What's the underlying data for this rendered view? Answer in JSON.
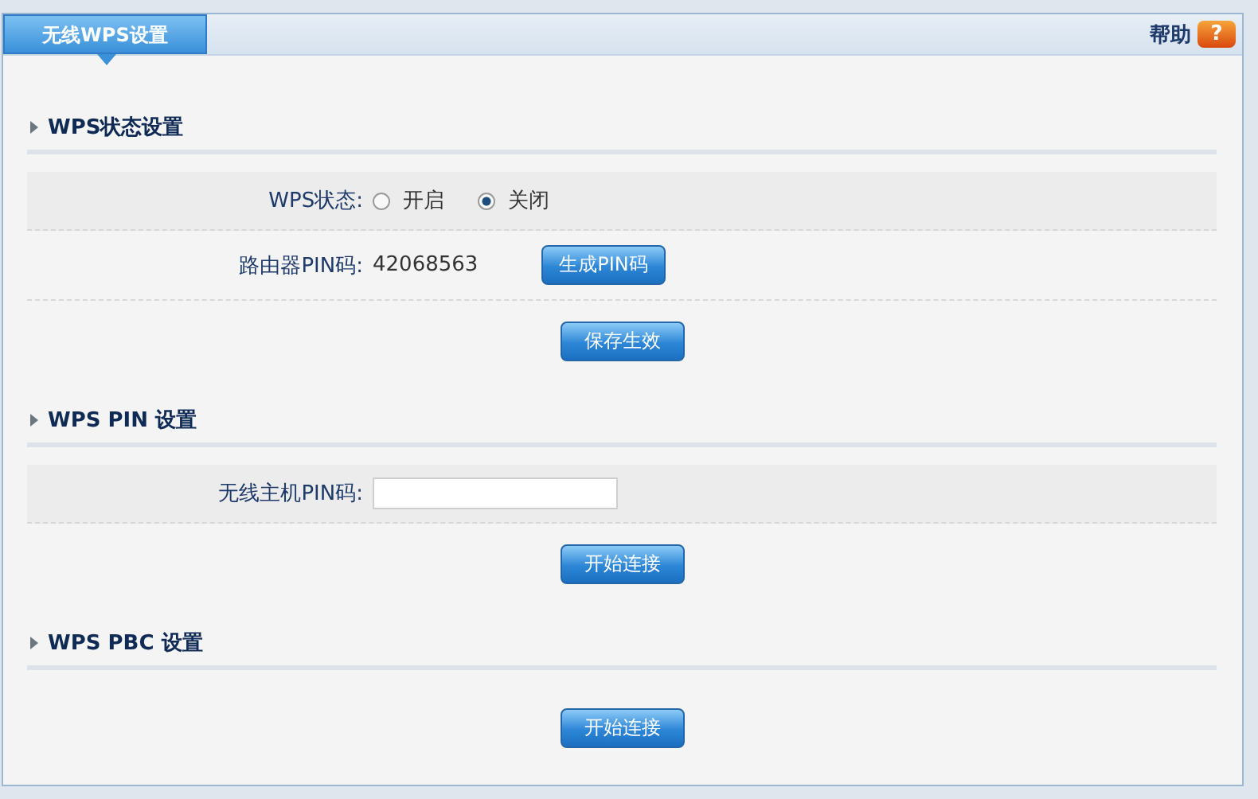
{
  "tab": {
    "label": "无线WPS设置",
    "selected": true
  },
  "help": {
    "label": "帮助",
    "icon": "?"
  },
  "sections": [
    {
      "title": "WPS状态设置",
      "rows": [
        {
          "kind": "radio",
          "label": "WPS状态:",
          "options": [
            {
              "label": "开启",
              "selected": false
            },
            {
              "label": "关闭",
              "selected": true
            }
          ]
        },
        {
          "kind": "value",
          "label": "路由器PIN码:",
          "value": "42068563",
          "button": "生成PIN码"
        }
      ],
      "button": "保存生效"
    },
    {
      "title": "WPS PIN 设置",
      "rows": [
        {
          "kind": "input",
          "label": "无线主机PIN码:"
        }
      ],
      "button": "开始连接"
    },
    {
      "title": "WPS PBC 设置",
      "button": "开始连接"
    }
  ]
}
